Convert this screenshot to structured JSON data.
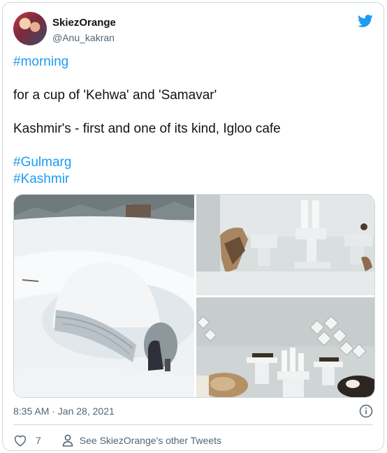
{
  "user": {
    "display_name": "SkiezOrange",
    "handle": "@Anu_kakran"
  },
  "tweet": {
    "lines": [
      "#morning",
      "for a cup of 'Kehwa' and  'Samavar'",
      "Kashmir's - first and one of its kind, Igloo cafe",
      "#Gulmarg",
      "#Kashmir"
    ]
  },
  "meta": {
    "timestamp": "8:35 AM · Jan 28, 2021"
  },
  "actions": {
    "like_count": "7",
    "profile_link": "See SkiezOrange's other Tweets"
  },
  "icons": {
    "brand": "twitter-bird-icon",
    "info": "info-icon",
    "like": "heart-icon",
    "profile": "person-icon"
  },
  "colors": {
    "accent": "#1d9bf0",
    "text": "#0f1419",
    "secondary": "#536471",
    "border": "#cfd9de"
  }
}
